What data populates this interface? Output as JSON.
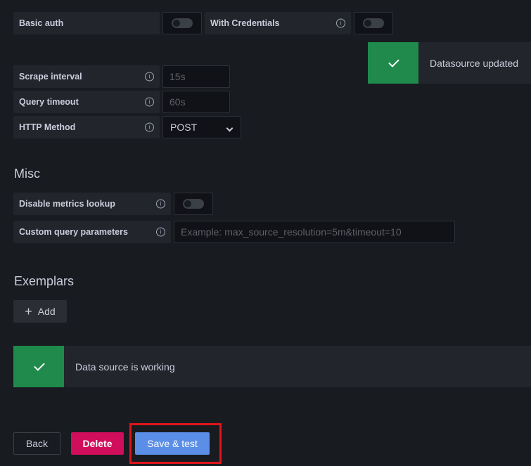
{
  "auth": {
    "basic_auth_label": "Basic auth",
    "with_credentials_label": "With Credentials"
  },
  "toast": {
    "message": "Datasource updated",
    "color": "#1f8a4c"
  },
  "fields": {
    "scrape_interval": {
      "label": "Scrape interval",
      "placeholder": "15s"
    },
    "query_timeout": {
      "label": "Query timeout",
      "placeholder": "60s"
    },
    "http_method": {
      "label": "HTTP Method",
      "value": "POST"
    }
  },
  "misc": {
    "heading": "Misc",
    "disable_metrics_lookup_label": "Disable metrics lookup",
    "custom_query_params_label": "Custom query parameters",
    "custom_query_params_placeholder": "Example: max_source_resolution=5m&timeout=10"
  },
  "exemplars": {
    "heading": "Exemplars",
    "add_label": "Add"
  },
  "alert": {
    "message": "Data source is working",
    "color": "#1f8a4c"
  },
  "actions": {
    "back_label": "Back",
    "delete_label": "Delete",
    "delete_color": "#d10e5c",
    "save_label": "Save & test",
    "save_color": "#5b8ee6",
    "highlight_color": "#e0141b"
  }
}
